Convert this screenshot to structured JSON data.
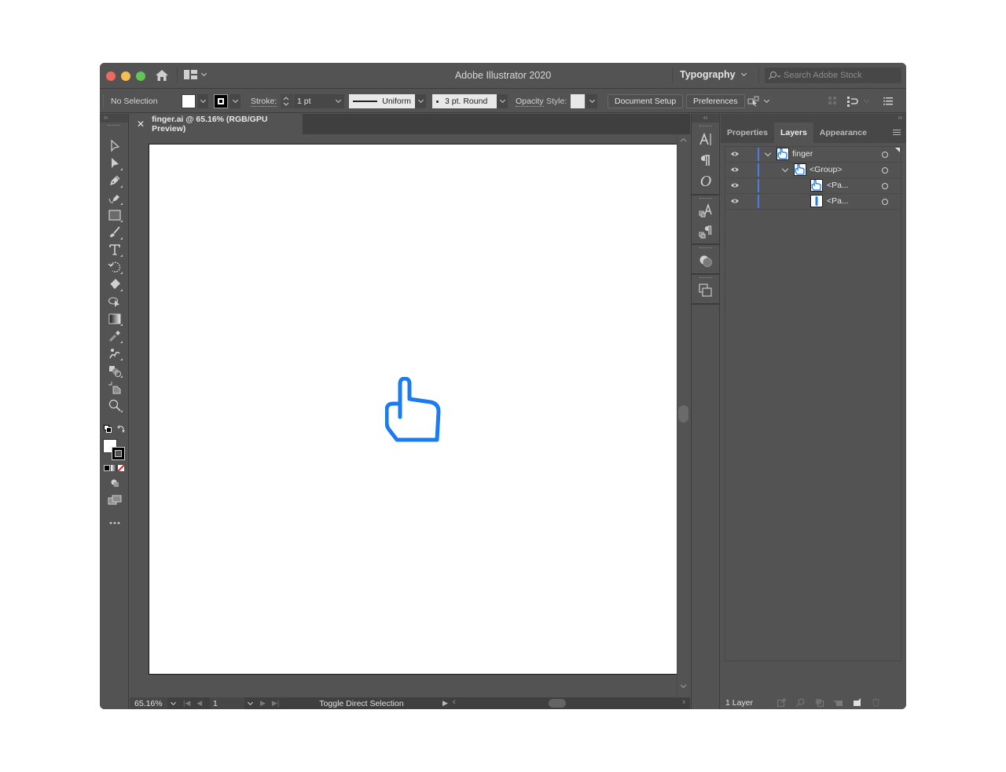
{
  "window": {
    "app_title": "Adobe Illustrator 2020",
    "workspace": "Typography",
    "search_placeholder": "Search Adobe Stock"
  },
  "controlbar": {
    "selection_status": "No Selection",
    "stroke_label": "Stroke:",
    "stroke_weight": "1 pt",
    "stroke_profile": "Uniform",
    "brush": "3 pt. Round",
    "opacity_label": "Opacity",
    "style_label": "Style:",
    "document_setup_label": "Document Setup",
    "preferences_label": "Preferences"
  },
  "tools": [
    {
      "name": "selection-tool"
    },
    {
      "name": "direct-selection-tool"
    },
    {
      "name": "pen-tool"
    },
    {
      "name": "curvature-tool"
    },
    {
      "name": "rectangle-tool"
    },
    {
      "name": "paintbrush-tool"
    },
    {
      "name": "type-tool"
    },
    {
      "name": "rotate-tool"
    },
    {
      "name": "eraser-tool"
    },
    {
      "name": "puppet-warp-tool"
    },
    {
      "name": "gradient-tool"
    },
    {
      "name": "eyedropper-tool"
    },
    {
      "name": "symbol-sprayer-tool"
    },
    {
      "name": "shape-builder-tool"
    },
    {
      "name": "artboard-tool"
    },
    {
      "name": "zoom-tool"
    }
  ],
  "document": {
    "tab_title": "finger.ai @ 65.16% (RGB/GPU Preview)",
    "artwork": "pointing-hand-icon",
    "artwork_color": "#1a7cf0"
  },
  "statusbar": {
    "zoom": "65.16%",
    "page": "1",
    "status_text": "Toggle Direct Selection"
  },
  "panel": {
    "tabs": [
      {
        "label": "Properties",
        "active": false
      },
      {
        "label": "Layers",
        "active": true
      },
      {
        "label": "Appearance",
        "active": false
      }
    ],
    "layers": [
      {
        "name": "finger",
        "depth": 0,
        "expanded": true,
        "visible": true
      },
      {
        "name": "<Group>",
        "depth": 1,
        "expanded": true,
        "visible": true
      },
      {
        "name": "<Pa...",
        "depth": 2,
        "expanded": false,
        "visible": true
      },
      {
        "name": "<Pa...",
        "depth": 2,
        "expanded": false,
        "visible": true
      }
    ],
    "footer_count": "1 Layer",
    "layer_color": "#4f7ce0"
  }
}
